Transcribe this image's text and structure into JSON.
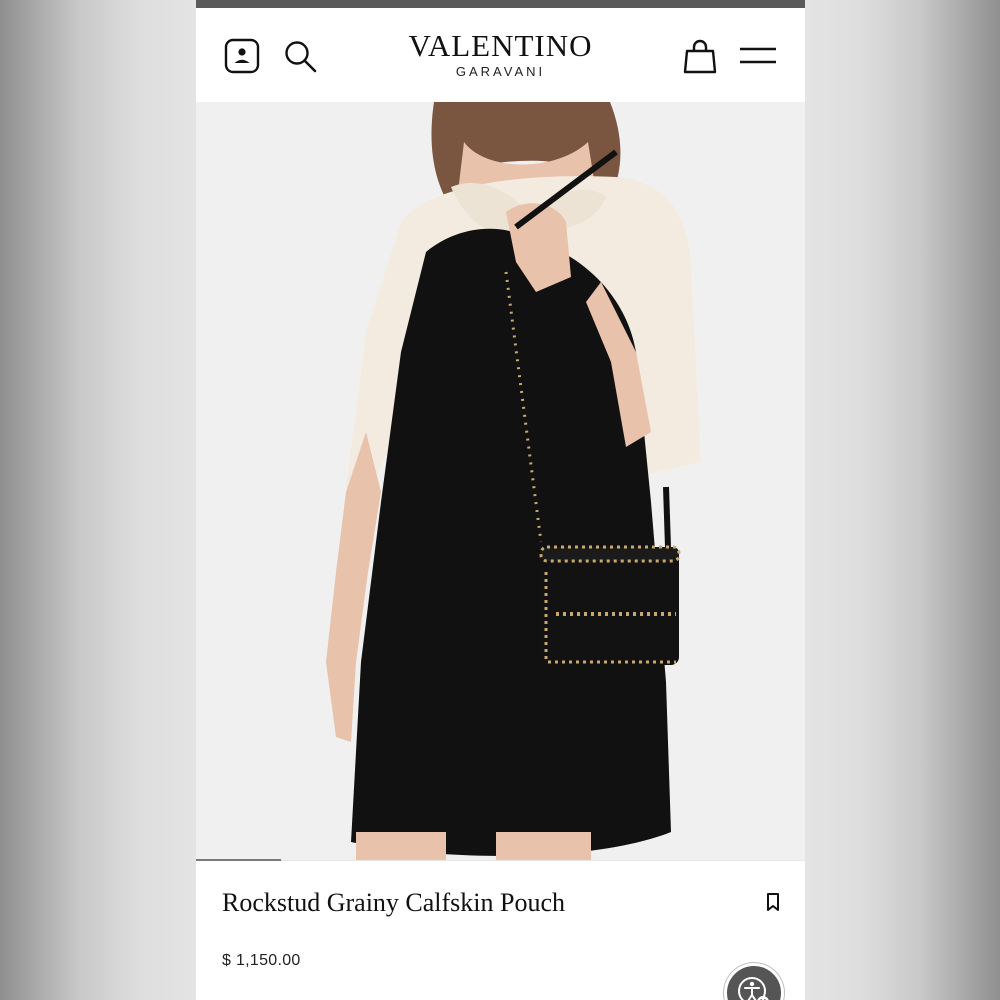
{
  "header": {
    "logo_main": "VALENTINO",
    "logo_sub": "GARAVANI",
    "icons": [
      "account-icon",
      "search-icon",
      "shopping-bag-icon",
      "hamburger-menu-icon"
    ]
  },
  "gallery": {
    "progress_fraction": 0.14
  },
  "product": {
    "name": "Rockstud Grainy Calfskin Pouch",
    "price": "$ 1,150.00",
    "wishlist_icon": "bookmark-icon"
  },
  "widgets": {
    "accessibility_icon": "accessibility-icon"
  },
  "colors": {
    "background": "#ffffff",
    "text": "#111111",
    "image_background": "#f1f0f0",
    "dress": "#111111",
    "cardigan": "#f3ebe0",
    "studs": "#c9a96e",
    "skin": "#e8c2aa"
  }
}
